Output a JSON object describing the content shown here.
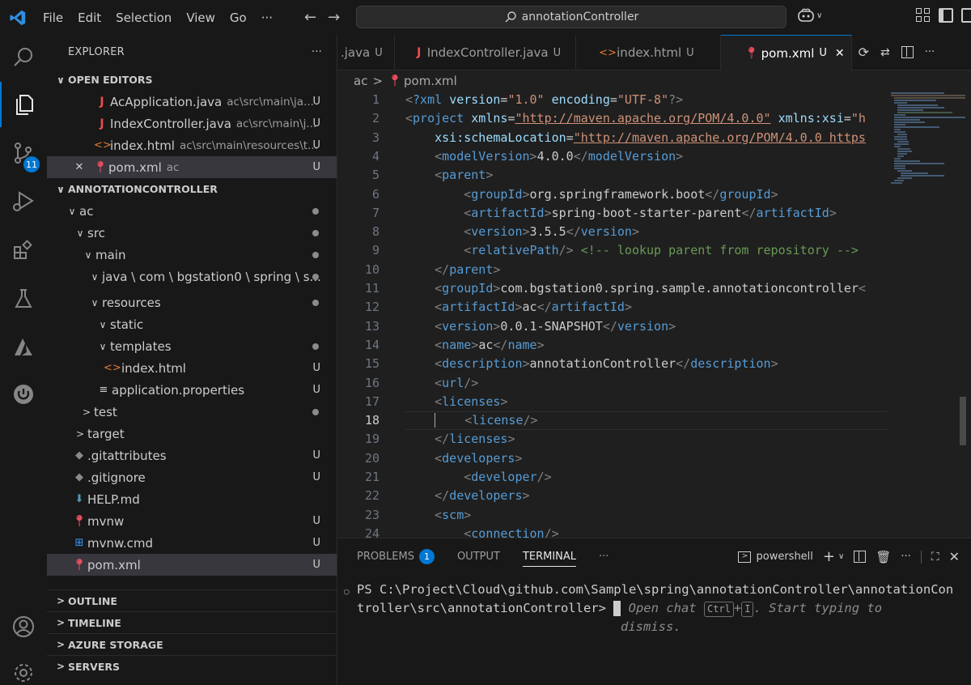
{
  "menu": [
    "File",
    "Edit",
    "Selection",
    "View",
    "Go",
    "···"
  ],
  "search": {
    "text": "annotationController"
  },
  "activity": {
    "scm_badge": "11"
  },
  "explorer": {
    "title": "EXPLORER",
    "more": "···",
    "open_editors_title": "OPEN EDITORS",
    "open_editors": [
      {
        "icon": "J",
        "name": "AcApplication.java",
        "desc": "ac\\src\\main\\ja...",
        "status": "U"
      },
      {
        "icon": "J",
        "name": "IndexController.java",
        "desc": "ac\\src\\main\\j...",
        "status": "U"
      },
      {
        "icon": "<>",
        "name": "index.html",
        "desc": "ac\\src\\main\\resources\\t...",
        "status": "U"
      },
      {
        "icon": "✕",
        "name": "pom.xml",
        "desc": "ac",
        "status": "U"
      }
    ],
    "project_title": "ANNOTATIONCONTROLLER",
    "tree": [
      {
        "chev": "∨",
        "name": "ac"
      },
      {
        "chev": "∨",
        "name": "src"
      },
      {
        "chev": "∨",
        "name": "main"
      },
      {
        "chev": "∨",
        "name": "java \\ com \\ bgstation0 \\ spring \\ s..."
      },
      {
        "chev": "∨",
        "name": "resources"
      },
      {
        "chev": "∨",
        "name": "static"
      },
      {
        "chev": "∨",
        "name": "templates"
      },
      {
        "name": "index.html",
        "status": "U"
      },
      {
        "name": "application.properties",
        "status": "U"
      },
      {
        "chev": ">",
        "name": "test"
      },
      {
        "chev": ">",
        "name": "target"
      },
      {
        "name": ".gitattributes",
        "status": "U"
      },
      {
        "name": ".gitignore",
        "status": "U"
      },
      {
        "name": "HELP.md"
      },
      {
        "name": "mvnw",
        "status": "U"
      },
      {
        "name": "mvnw.cmd",
        "status": "U"
      },
      {
        "name": "pom.xml",
        "status": "U"
      }
    ],
    "bottom_sections": [
      "OUTLINE",
      "TIMELINE",
      "AZURE STORAGE",
      "SERVERS"
    ]
  },
  "tabs": [
    {
      "name": ".java",
      "status": "U"
    },
    {
      "name": "IndexController.java",
      "status": "U"
    },
    {
      "name": "index.html",
      "status": "U"
    },
    {
      "name": "pom.xml",
      "status": "U",
      "close": "✕"
    }
  ],
  "tab_more": "···",
  "breadcrumb": {
    "folder": "ac",
    "sep": ">",
    "file": "pom.xml"
  },
  "line_numbers": [
    "1",
    "2",
    "3",
    "4",
    "5",
    "6",
    "7",
    "8",
    "9",
    "10",
    "11",
    "12",
    "13",
    "14",
    "15",
    "16",
    "17",
    "18",
    "19",
    "20",
    "21",
    "22",
    "23",
    "24"
  ],
  "panel": {
    "tabs": [
      "PROBLEMS",
      "OUTPUT",
      "TERMINAL",
      "···"
    ],
    "problems_count": "1",
    "shell": "powershell",
    "terminal_line1": "PS C:\\Project\\Cloud\\github.com\\Sample\\spring\\annotationController\\annotationCon",
    "terminal_line2": "troller\\src\\annotationController> ",
    "hint_open": "Open chat",
    "hint_key1": "Ctrl",
    "hint_plus": "+",
    "hint_key2": "I",
    "hint_rest": ". Start typing to",
    "hint_dismiss": "dismiss."
  }
}
